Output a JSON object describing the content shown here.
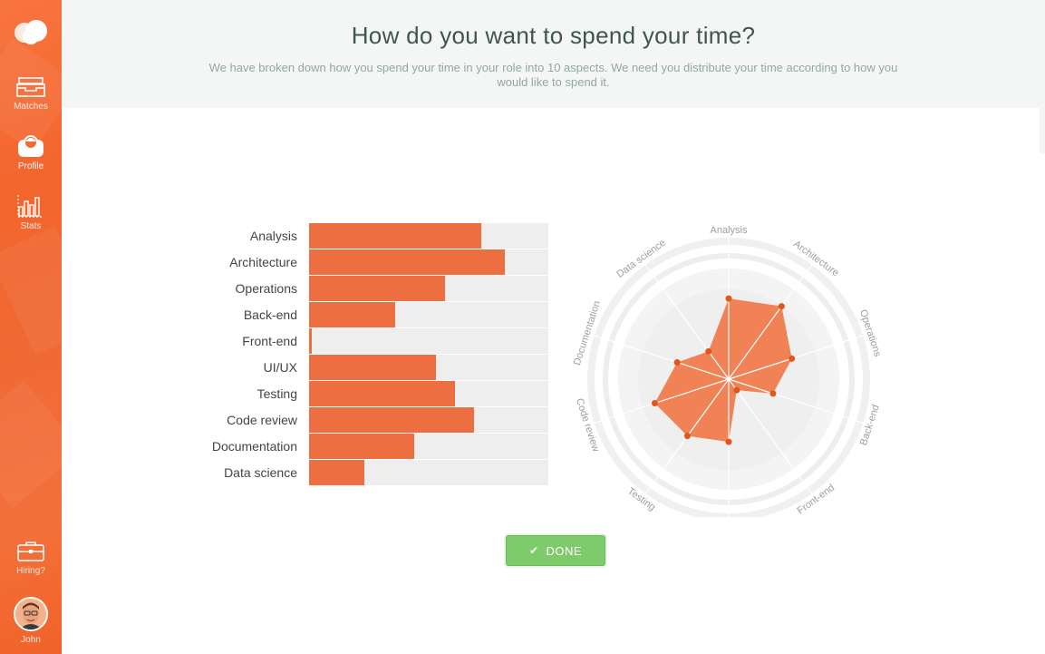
{
  "sidebar": {
    "nav": [
      {
        "label": "Matches",
        "icon": "inbox-icon"
      },
      {
        "label": "Profile",
        "icon": "profile-icon"
      },
      {
        "label": "Stats",
        "icon": "stats-icon"
      }
    ],
    "hiring_label": "Hiring?",
    "user_name": "John"
  },
  "header": {
    "title": "How do you want to spend your time?",
    "subtitle": "We have broken down how you spend your time in your role into 10 aspects. We need you distribute your time according to how you would like to spend it."
  },
  "chart_data": {
    "type": "bar",
    "orientation": "horizontal",
    "categories": [
      "Analysis",
      "Architecture",
      "Operations",
      "Back-end",
      "Front-end",
      "UI/UX",
      "Testing",
      "Code review",
      "Documentation",
      "Data science"
    ],
    "values": [
      72,
      82,
      57,
      36,
      1,
      53,
      61,
      69,
      44,
      23
    ],
    "xlim": [
      0,
      100
    ],
    "bar_color": "#ec6e41",
    "track_color": "#eeeeee"
  },
  "radar": {
    "axes": [
      "Analysis",
      "Architecture",
      "Operations",
      "Back-end",
      "Front-end",
      "UI/UX",
      "Testing",
      "Code review",
      "Documentation",
      "Data science"
    ],
    "fill_color": "#ef7b4c",
    "point_color": "#e2561d"
  },
  "actions": {
    "done_label": "DONE"
  },
  "colors": {
    "sidebar": "#f26a31",
    "header_bg": "#f3f6f5",
    "done": "#7ecb6b"
  }
}
